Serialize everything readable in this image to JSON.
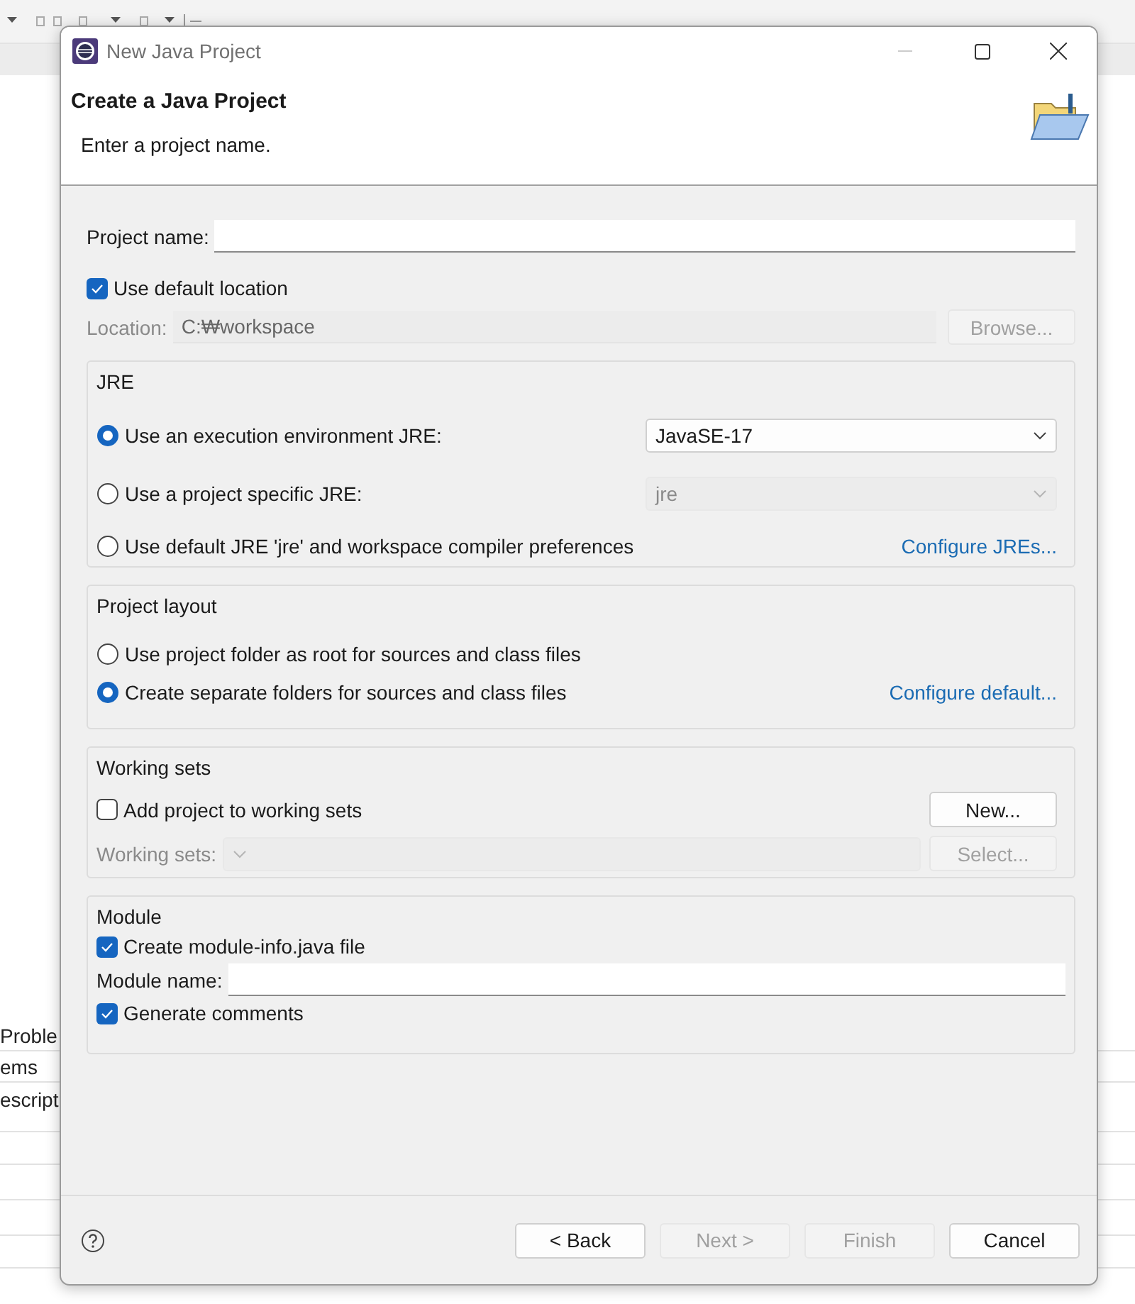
{
  "background": {
    "texts": [
      "Proble",
      "ems",
      "escript"
    ]
  },
  "window": {
    "title": "New Java Project"
  },
  "header": {
    "title": "Create a Java Project",
    "message": "Enter a project name."
  },
  "project_name": {
    "label": "Project name:"
  },
  "use_default_location": {
    "label": "Use default location",
    "checked": true
  },
  "location": {
    "label": "Location:",
    "value": "C:₩workspace",
    "disabled": true,
    "button": {
      "label": "Browse...",
      "disabled": true
    }
  },
  "jre": {
    "title": "JRE",
    "options": [
      {
        "label": "Use an execution environment JRE:",
        "selected": true,
        "kind": "select",
        "value": "JavaSE-17",
        "disabled": false
      },
      {
        "label": "Use a project specific JRE:",
        "selected": false,
        "kind": "select",
        "value": "jre",
        "disabled": true
      },
      {
        "label": "Use default JRE 'jre' and workspace compiler preferences",
        "selected": false,
        "kind": "link",
        "link": "Configure JREs..."
      }
    ]
  },
  "project_layout": {
    "title": "Project layout",
    "options": [
      {
        "label": "Use project folder as root for sources and class files",
        "selected": false,
        "kind": "plain"
      },
      {
        "label": "Create separate folders for sources and class files",
        "selected": true,
        "kind": "link",
        "link": "Configure default..."
      }
    ]
  },
  "working_sets": {
    "title": "Working sets",
    "checkbox": {
      "label": "Add project to working sets",
      "checked": false
    },
    "new_button": {
      "label": "New...",
      "disabled": false
    },
    "select": {
      "label": "Working sets:",
      "disabled": true
    },
    "select_button": {
      "label": "Select...",
      "disabled": true
    }
  },
  "module": {
    "title": "Module",
    "create": {
      "label": "Create module-info.java file",
      "checked": true
    },
    "name": {
      "label": "Module name:"
    },
    "comments": {
      "label": "Generate comments",
      "checked": true
    }
  },
  "footer": {
    "buttons": [
      {
        "label": "< Back",
        "disabled": false
      },
      {
        "label": "Next >",
        "disabled": true
      },
      {
        "label": "Finish",
        "disabled": true
      },
      {
        "label": "Cancel",
        "disabled": false
      }
    ]
  }
}
